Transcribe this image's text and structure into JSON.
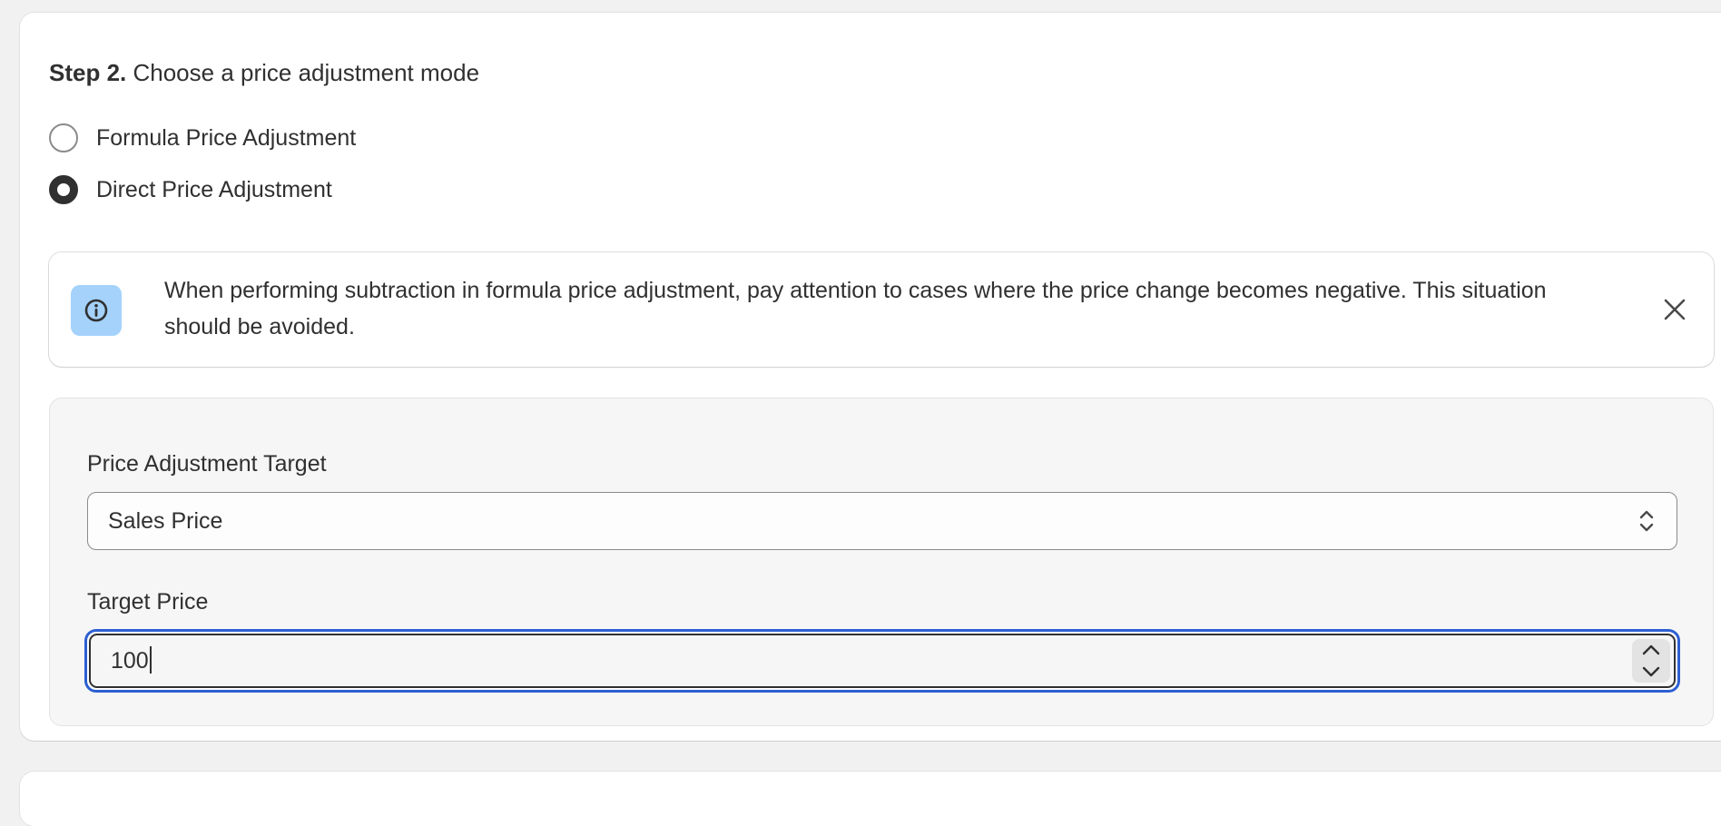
{
  "heading": {
    "step": "Step 2.",
    "title": "Choose a price adjustment mode"
  },
  "mode_options": [
    {
      "label": "Formula Price Adjustment",
      "checked": false
    },
    {
      "label": "Direct Price Adjustment",
      "checked": true
    }
  ],
  "banner": {
    "icon": "info-icon",
    "text": "When performing subtraction in formula price adjustment, pay attention to cases where the price change becomes negative. This situation should be avoided.",
    "close_icon": "close-icon"
  },
  "form": {
    "target_label": "Price Adjustment Target",
    "target_value": "Sales Price",
    "target_icon": "select-arrows-icon",
    "price_label": "Target Price",
    "price_value": "100",
    "stepper_up_icon": "chevron-up-icon",
    "stepper_down_icon": "chevron-down-icon"
  },
  "colors": {
    "focus_ring": "#2c5fd1",
    "info_icon_bg": "#a4d2fb",
    "text": "#303030",
    "page_bg": "#f1f1f1"
  }
}
